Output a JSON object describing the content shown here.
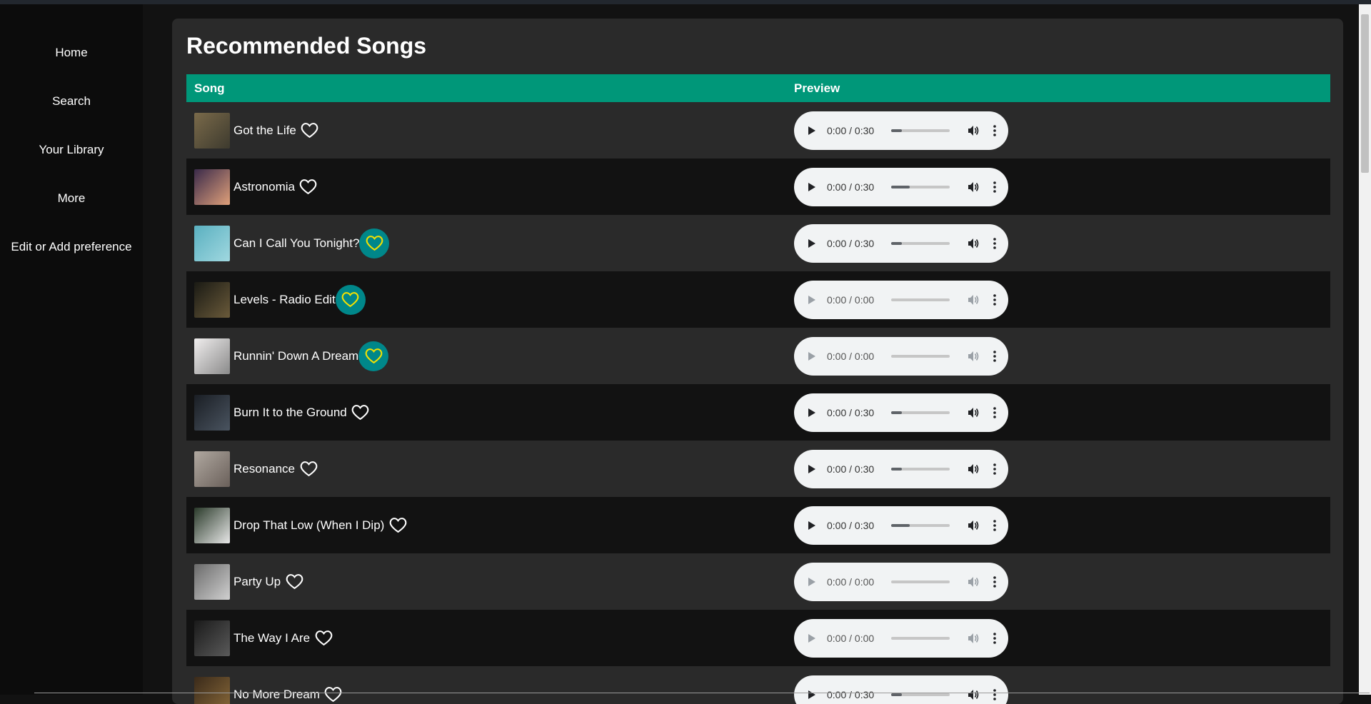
{
  "sidebar": {
    "items": [
      {
        "label": "Home"
      },
      {
        "label": "Search"
      },
      {
        "label": "Your Library"
      },
      {
        "label": "More"
      },
      {
        "label": "Edit or Add preference"
      }
    ]
  },
  "main": {
    "title": "Recommended Songs",
    "columns": {
      "song": "Song",
      "preview": "Preview"
    },
    "songs": [
      {
        "name": "Got the Life",
        "liked": false,
        "time": "0:00 / 0:30",
        "enabled": true,
        "progress": 0.18,
        "cover": [
          "#7a6a4a",
          "#3d3a2e"
        ]
      },
      {
        "name": "Astronomia",
        "liked": false,
        "time": "0:00 / 0:30",
        "enabled": true,
        "progress": 0.32,
        "cover": [
          "#3a2a4a",
          "#e0a07a"
        ]
      },
      {
        "name": "Can I Call You Tonight?",
        "liked": true,
        "time": "0:00 / 0:30",
        "enabled": true,
        "progress": 0.18,
        "cover": [
          "#5ab0c0",
          "#a0d8e0"
        ]
      },
      {
        "name": "Levels - Radio Edit",
        "liked": true,
        "time": "0:00 / 0:00",
        "enabled": false,
        "progress": 0,
        "cover": [
          "#1a1a14",
          "#6a5a3a"
        ]
      },
      {
        "name": "Runnin' Down A Dream",
        "liked": true,
        "time": "0:00 / 0:00",
        "enabled": false,
        "progress": 0,
        "cover": [
          "#f0eeee",
          "#8a8a8a"
        ]
      },
      {
        "name": "Burn It to the Ground",
        "liked": false,
        "time": "0:00 / 0:30",
        "enabled": true,
        "progress": 0.18,
        "cover": [
          "#1a1e24",
          "#4a5460"
        ]
      },
      {
        "name": "Resonance",
        "liked": false,
        "time": "0:00 / 0:30",
        "enabled": true,
        "progress": 0.18,
        "cover": [
          "#b0a8a0",
          "#6a605a"
        ]
      },
      {
        "name": "Drop That Low (When I Dip)",
        "liked": false,
        "time": "0:00 / 0:30",
        "enabled": true,
        "progress": 0.32,
        "cover": [
          "#2a3a2a",
          "#e8e8e8"
        ]
      },
      {
        "name": "Party Up",
        "liked": false,
        "time": "0:00 / 0:00",
        "enabled": false,
        "progress": 0,
        "cover": [
          "#6a6a6a",
          "#d0d0d0"
        ]
      },
      {
        "name": "The Way I Are",
        "liked": false,
        "time": "0:00 / 0:00",
        "enabled": false,
        "progress": 0,
        "cover": [
          "#1a1a1a",
          "#5a5a5a"
        ]
      },
      {
        "name": "No More Dream",
        "liked": false,
        "time": "0:00 / 0:30",
        "enabled": true,
        "progress": 0.18,
        "cover": [
          "#3a2a1a",
          "#8a6a3a"
        ]
      }
    ]
  },
  "colors": {
    "header_bg": "#009779",
    "liked_bg": "#00878a",
    "liked_heart": "#f5e100"
  }
}
